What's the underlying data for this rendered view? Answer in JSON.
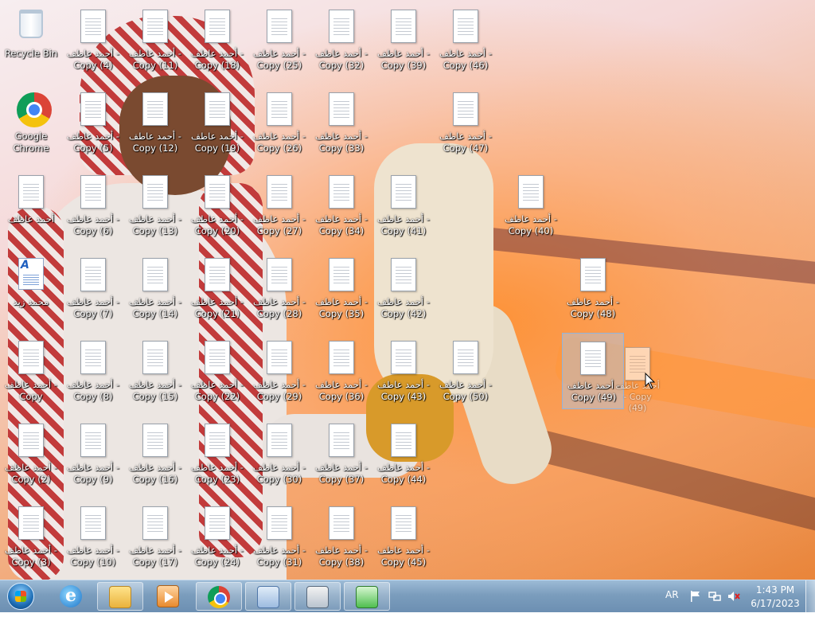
{
  "desktop": {
    "icons": [
      {
        "id": "recycle-bin",
        "label": "Recycle Bin",
        "kind": "recycle"
      },
      {
        "id": "google-chrome",
        "label": "Google Chrome",
        "kind": "chrome"
      },
      {
        "id": "ahmed-aatef",
        "label": "أحمد عاطف",
        "kind": "doc"
      },
      {
        "id": "mohamed-zaid",
        "label": "محمد زيد",
        "kind": "wordpad"
      },
      {
        "id": "copy",
        "label": "أحمد عاطف - Copy",
        "kind": "doc"
      },
      {
        "id": "copy-2",
        "label": "أحمد عاطف - Copy (2)",
        "kind": "doc"
      },
      {
        "id": "copy-3",
        "label": "أحمد عاطف - Copy (3)",
        "kind": "doc"
      },
      {
        "id": "copy-4",
        "label": "أحمد عاطف - Copy (4)",
        "kind": "doc"
      },
      {
        "id": "copy-5",
        "label": "أحمد عاطف - Copy (5)",
        "kind": "doc"
      },
      {
        "id": "copy-6",
        "label": "أحمد عاطف - Copy (6)",
        "kind": "doc"
      },
      {
        "id": "copy-7",
        "label": "أحمد عاطف - Copy (7)",
        "kind": "doc"
      },
      {
        "id": "copy-8",
        "label": "أحمد عاطف - Copy (8)",
        "kind": "doc"
      },
      {
        "id": "copy-9",
        "label": "أحمد عاطف - Copy (9)",
        "kind": "doc"
      },
      {
        "id": "copy-10",
        "label": "أحمد عاطف - Copy (10)",
        "kind": "doc"
      },
      {
        "id": "copy-11",
        "label": "أحمد عاطف - Copy (11)",
        "kind": "doc"
      },
      {
        "id": "copy-12",
        "label": "أحمد عاطف - Copy (12)",
        "kind": "doc"
      },
      {
        "id": "copy-13",
        "label": "أحمد عاطف - Copy (13)",
        "kind": "doc"
      },
      {
        "id": "copy-14",
        "label": "أحمد عاطف - Copy (14)",
        "kind": "doc"
      },
      {
        "id": "copy-15",
        "label": "أحمد عاطف - Copy (15)",
        "kind": "doc"
      },
      {
        "id": "copy-16",
        "label": "أحمد عاطف - Copy (16)",
        "kind": "doc"
      },
      {
        "id": "copy-17",
        "label": "أحمد عاطف - Copy (17)",
        "kind": "doc"
      },
      {
        "id": "copy-18",
        "label": "أحمد عاطف - Copy (18)",
        "kind": "doc"
      },
      {
        "id": "copy-19",
        "label": "أحمد عاطف - Copy (19)",
        "kind": "doc"
      },
      {
        "id": "copy-20",
        "label": "أحمد عاطف - Copy (20)",
        "kind": "doc"
      },
      {
        "id": "copy-21",
        "label": "أحمد عاطف - Copy (21)",
        "kind": "doc"
      },
      {
        "id": "copy-22",
        "label": "أحمد عاطف - Copy (22)",
        "kind": "doc"
      },
      {
        "id": "copy-23",
        "label": "أحمد عاطف - Copy (23)",
        "kind": "doc"
      },
      {
        "id": "copy-24",
        "label": "أحمد عاطف - Copy (24)",
        "kind": "doc"
      },
      {
        "id": "copy-25",
        "label": "أحمد عاطف - Copy (25)",
        "kind": "doc"
      },
      {
        "id": "copy-26",
        "label": "أحمد عاطف - Copy (26)",
        "kind": "doc"
      },
      {
        "id": "copy-27",
        "label": "أحمد عاطف - Copy (27)",
        "kind": "doc"
      },
      {
        "id": "copy-28",
        "label": "أحمد عاطف - Copy (28)",
        "kind": "doc"
      },
      {
        "id": "copy-29",
        "label": "أحمد عاطف - Copy (29)",
        "kind": "doc"
      },
      {
        "id": "copy-30",
        "label": "أحمد عاطف - Copy (30)",
        "kind": "doc"
      },
      {
        "id": "copy-31",
        "label": "أحمد عاطف - Copy (31)",
        "kind": "doc"
      },
      {
        "id": "copy-32",
        "label": "أحمد عاطف - Copy (32)",
        "kind": "doc"
      },
      {
        "id": "copy-33",
        "label": "أحمد عاطف - Copy (33)",
        "kind": "doc"
      },
      {
        "id": "copy-34",
        "label": "أحمد عاطف - Copy (34)",
        "kind": "doc"
      },
      {
        "id": "copy-35",
        "label": "أحمد عاطف - Copy (35)",
        "kind": "doc"
      },
      {
        "id": "copy-36",
        "label": "أحمد عاطف - Copy (36)",
        "kind": "doc"
      },
      {
        "id": "copy-37",
        "label": "أحمد عاطف - Copy (37)",
        "kind": "doc"
      },
      {
        "id": "copy-38",
        "label": "أحمد عاطف - Copy (38)",
        "kind": "doc"
      },
      {
        "id": "copy-39",
        "label": "أحمد عاطف - Copy (39)",
        "kind": "doc"
      },
      {
        "id": "copy-41",
        "label": "أحمد عاطف - Copy (41)",
        "kind": "doc"
      },
      {
        "id": "copy-42",
        "label": "أحمد عاطف - Copy (42)",
        "kind": "doc"
      },
      {
        "id": "copy-43",
        "label": "أحمد عاطف - Copy (43)",
        "kind": "doc"
      },
      {
        "id": "copy-44",
        "label": "أحمد عاطف - Copy (44)",
        "kind": "doc"
      },
      {
        "id": "copy-45",
        "label": "أحمد عاطف - Copy (45)",
        "kind": "doc"
      },
      {
        "id": "copy-46",
        "label": "أحمد عاطف - Copy (46)",
        "kind": "doc"
      },
      {
        "id": "copy-47",
        "label": "أحمد عاطف - Copy (47)",
        "kind": "doc"
      },
      {
        "id": "copy-50",
        "label": "أحمد عاطف - Copy (50)",
        "kind": "doc"
      },
      {
        "id": "copy-40",
        "label": "أحمد عاطف - Copy (40)",
        "kind": "doc"
      },
      {
        "id": "copy-48",
        "label": "أحمد عاطف - Copy (48)",
        "kind": "doc"
      },
      {
        "id": "copy-49",
        "label": "أحمد عاطف - Copy (49)",
        "kind": "doc",
        "selected": true
      }
    ],
    "drag_ghost_label": "أحمد عاطف - Copy (49)"
  },
  "taskbar": {
    "start_label": "Start",
    "pinned": [
      {
        "id": "internet-explorer",
        "icon": "internet-explorer-icon"
      },
      {
        "id": "windows-explorer",
        "icon": "folder-icon"
      },
      {
        "id": "media-player",
        "icon": "media-player-icon"
      },
      {
        "id": "google-chrome",
        "icon": "chrome-icon"
      },
      {
        "id": "control-panel",
        "icon": "control-panel-icon"
      },
      {
        "id": "on-screen-keyboard",
        "icon": "keyboard-icon"
      },
      {
        "id": "app-green",
        "icon": "green-app-icon"
      }
    ],
    "tray": {
      "language": "AR",
      "time": "1:43 PM",
      "date": "6/17/2023"
    }
  },
  "colors": {
    "taskbar": "#7b9dbd",
    "selection": "#aac8eb"
  }
}
